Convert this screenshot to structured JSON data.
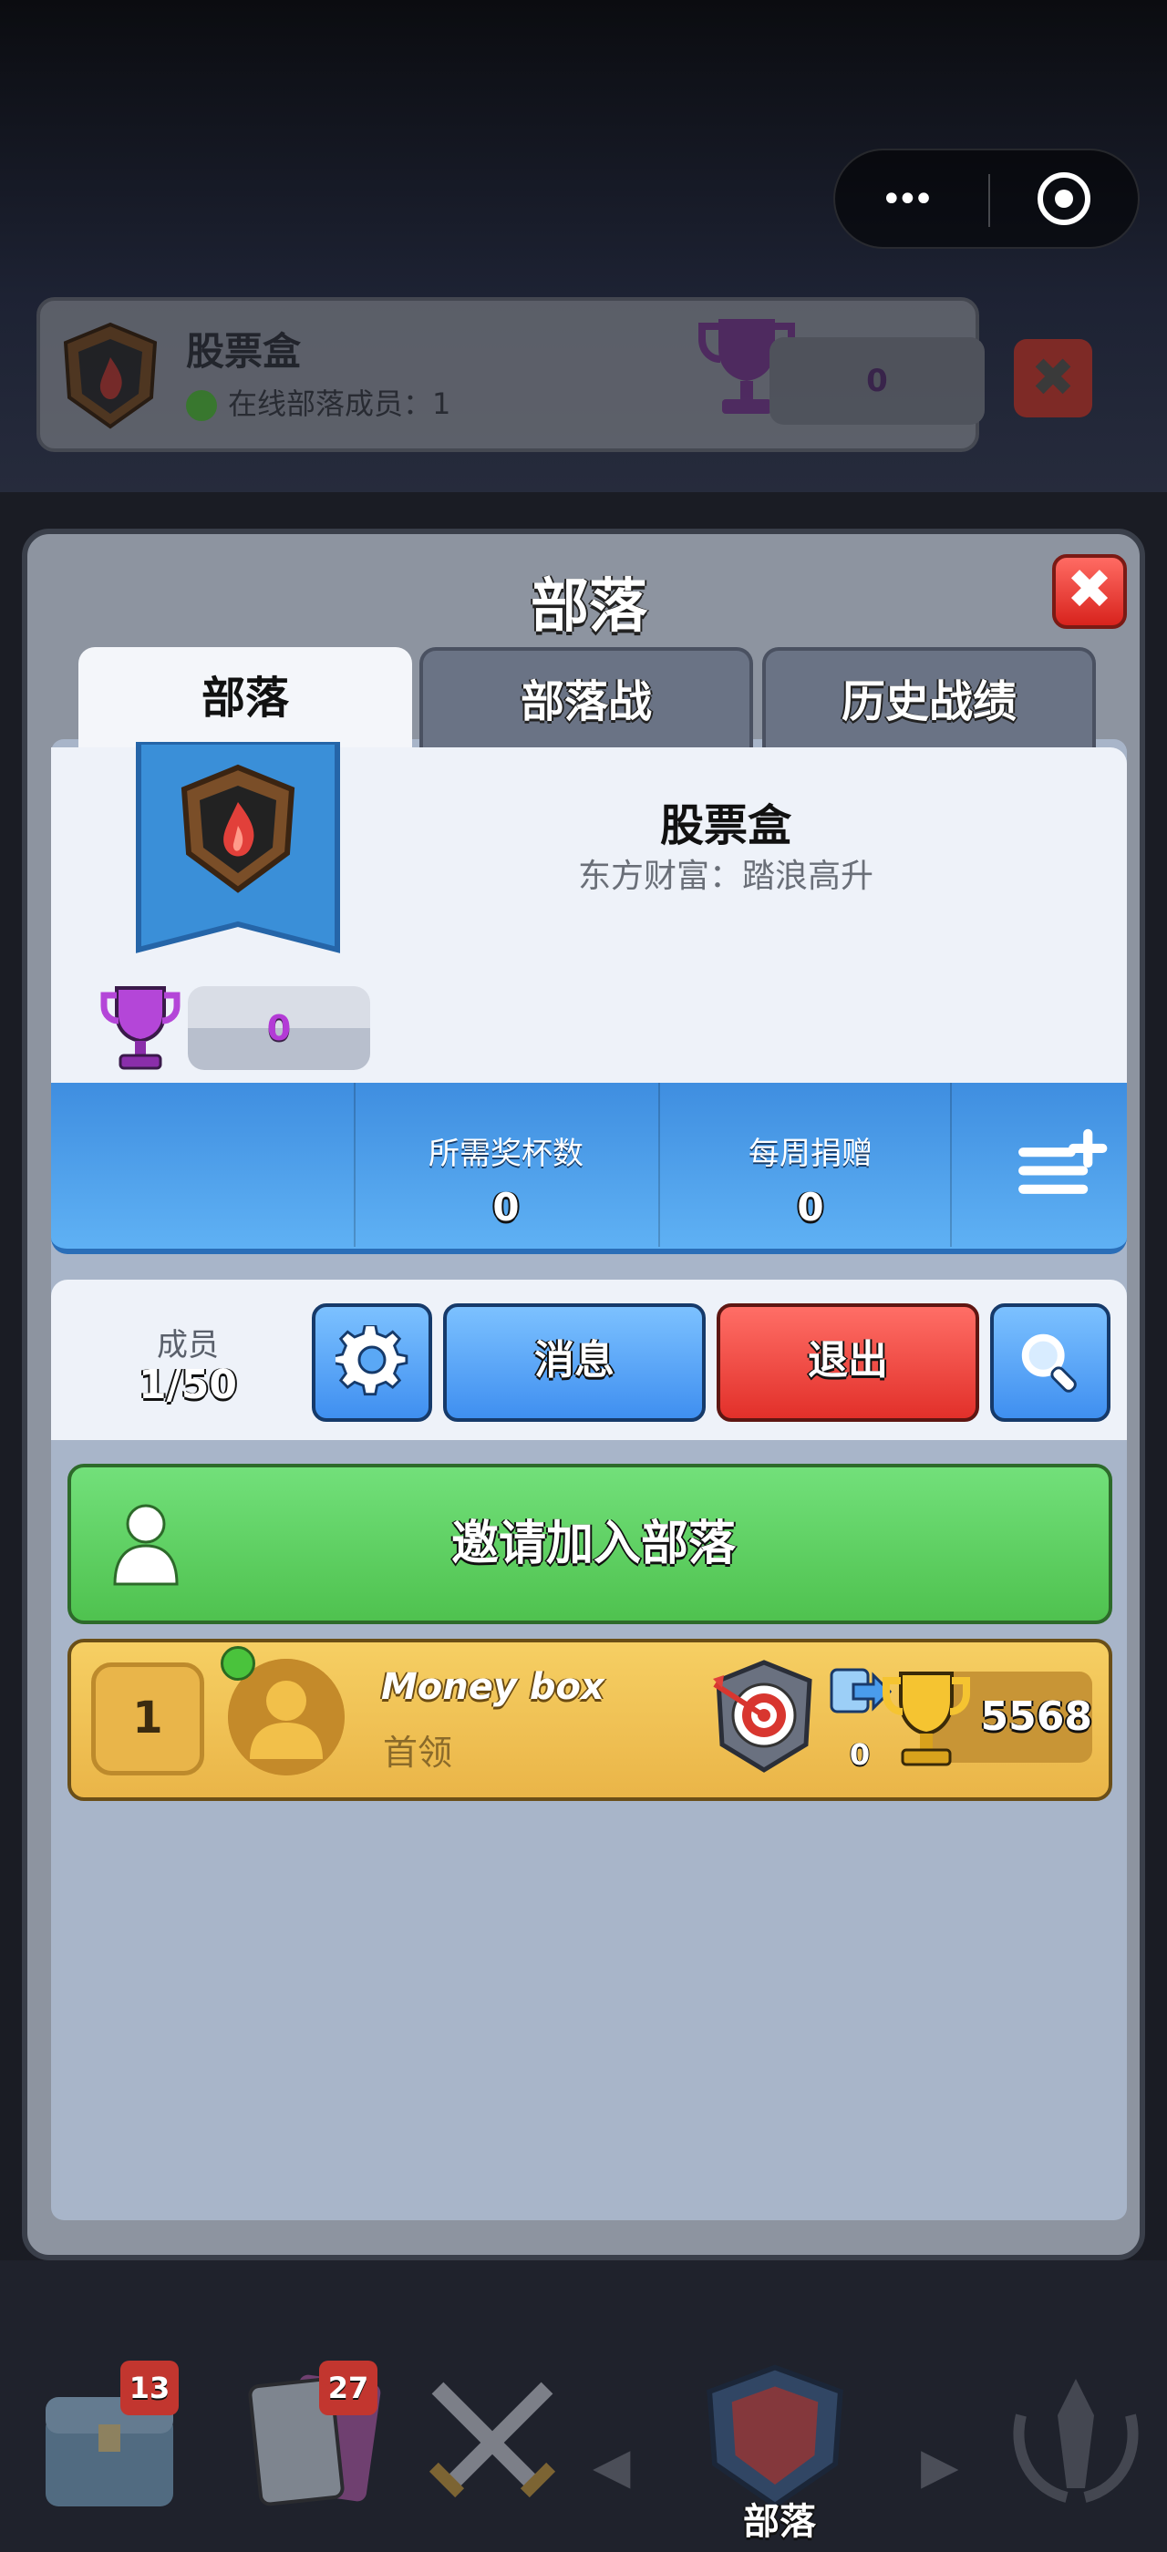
{
  "background": {
    "clan_name": "股票盒",
    "online_members": "在线部落成员：1",
    "trophies": "0",
    "close": "✖"
  },
  "capsule": {
    "more": "•••"
  },
  "dialog": {
    "title": "部落",
    "close": "✖",
    "tabs": [
      {
        "label": "部落",
        "active": true
      },
      {
        "label": "部落战",
        "active": false
      },
      {
        "label": "历史战绩",
        "active": false
      }
    ],
    "clan": {
      "name": "股票盒",
      "description": "东方财富：踏浪高升",
      "trophies": "0"
    },
    "stats": {
      "required_trophies_label": "所需奖杯数",
      "required_trophies": "0",
      "weekly_donations_label": "每周捐赠",
      "weekly_donations": "0"
    },
    "members": {
      "label": "成员",
      "count": "1/50",
      "message_button": "消息",
      "leave_button": "退出"
    },
    "invite_button": "邀请加入部落",
    "member_list": [
      {
        "rank": "1",
        "name": "Money box",
        "role": "首领",
        "donations": "0",
        "trophies": "5568",
        "online": true
      }
    ]
  },
  "nav": {
    "badges": [
      "13",
      "27"
    ],
    "active_label": "部落"
  },
  "colors": {
    "accent_blue": "#4a9cec",
    "leave_red": "#e2302a",
    "invite_green": "#5ecb5f",
    "member_gold": "#f0c053"
  }
}
